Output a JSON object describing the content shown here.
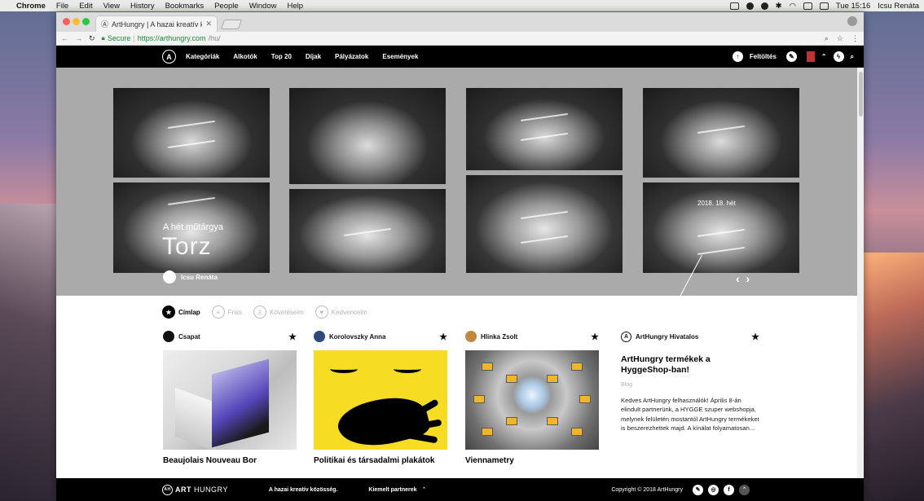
{
  "menubar": {
    "app": "Chrome",
    "items": [
      "File",
      "Edit",
      "View",
      "History",
      "Bookmarks",
      "People",
      "Window",
      "Help"
    ],
    "clock": "Tue 15:16",
    "user": "Icsu Renáta"
  },
  "browser": {
    "tab_title": "ArtHungry | A hazai kreatív kö",
    "secure_label": "Secure",
    "url_host": "https://arthungry.com",
    "url_path": "/hu/"
  },
  "nav": {
    "links": [
      "Kategóriák",
      "Alkotók",
      "Top 20",
      "Díjak",
      "Pályázatok",
      "Események"
    ],
    "upload_label": "Feltöltés"
  },
  "hero": {
    "kicker": "A hét műtárgya",
    "title": "Torz",
    "author": "Icsu Renáta",
    "week": "2018. 18. hét",
    "arrows": "‹ ›"
  },
  "filters": [
    {
      "label": "Címlap",
      "icon": "star-icon",
      "active": true
    },
    {
      "label": "Friss",
      "icon": "list-icon",
      "active": false
    },
    {
      "label": "Követéseim",
      "icon": "person-icon",
      "active": false
    },
    {
      "label": "Kedvenceim",
      "icon": "heart-icon",
      "active": false
    }
  ],
  "cards": [
    {
      "author": "Csapat",
      "title": "Beaujolais Nouveau Bor"
    },
    {
      "author": "Korolovszky Anna",
      "title": "Politikai és társadalmi plakátok"
    },
    {
      "author": "Hlinka Zsolt",
      "title": "Viennametry"
    }
  ],
  "blog": {
    "author": "ArtHungry Hivatalos",
    "title": "ArtHungry termékek a HyggeShop-ban!",
    "category": "Blog",
    "excerpt": "Kedves ArtHungry felhasználók! Április 8-án elindult partnerünk, a HYGGE szuper webshopja, melynek felületén mostantól ArtHungry termékeket is beszerezhettek majd. A kínálat folyamatosan..."
  },
  "footer": {
    "logo_a": "ART",
    "logo_b": "HUNGRY",
    "tagline": "A hazai kreatív közösség.",
    "partners": "Kiemelt partnerek",
    "copyright": "Copyright © 2018 ArtHungry"
  },
  "colors": {
    "nav_bg": "#000000",
    "hero_bg": "#aaaaaa",
    "secure_green": "#1b8a36",
    "poster_yellow": "#f6dd23"
  }
}
